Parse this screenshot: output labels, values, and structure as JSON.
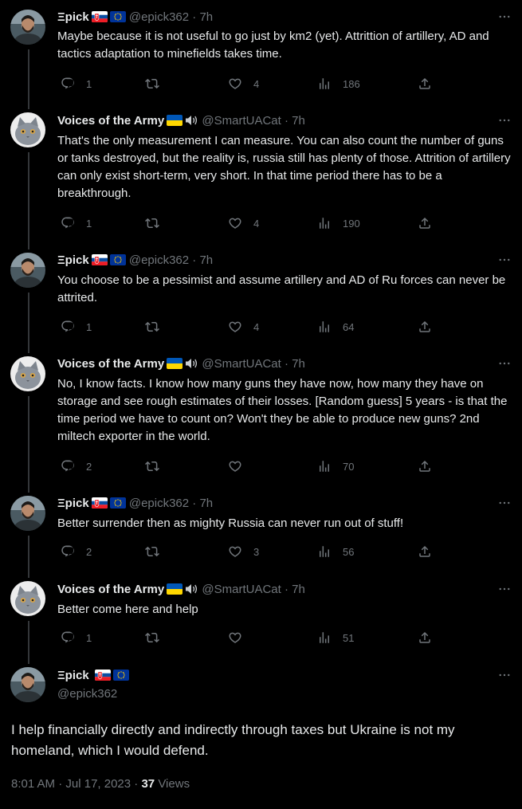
{
  "replies": [
    {
      "name": "Ξpick",
      "handle": "@epick362",
      "sep": "·",
      "time": "7h",
      "avatar": "bearded-man-avatar",
      "flags": [
        "slovakia-flag",
        "eu-flag"
      ],
      "text": "Maybe because it is not useful to go just by km2 (yet). Attrittion of artillery, AD and tactics adaptation to minefields takes time.",
      "replies": "1",
      "likes": "4",
      "views": "186"
    },
    {
      "name": "Voices of the Army",
      "handle": "@SmartUACat",
      "sep": "·",
      "time": "7h",
      "avatar": "gray-cat-avatar",
      "flags": [
        "ukraine-flag",
        "speaker-icon"
      ],
      "text": "That's the only measurement I can measure. You can also count the number of guns or tanks destroyed, but the reality is, russia still has plenty of those. Attrition of artillery can only exist short-term, very short. In that time period there has to be a breakthrough.",
      "replies": "1",
      "likes": "4",
      "views": "190"
    },
    {
      "name": "Ξpick",
      "handle": "@epick362",
      "sep": "·",
      "time": "7h",
      "avatar": "bearded-man-avatar",
      "flags": [
        "slovakia-flag",
        "eu-flag"
      ],
      "text": "You choose to be a pessimist and assume artillery and AD of Ru forces can never be attrited.",
      "replies": "1",
      "likes": "4",
      "views": "64"
    },
    {
      "name": "Voices of the Army",
      "handle": "@SmartUACat",
      "sep": "·",
      "time": "7h",
      "avatar": "gray-cat-avatar",
      "flags": [
        "ukraine-flag",
        "speaker-icon"
      ],
      "text": "No, I know facts. I know how many guns they have now, how many they have on storage and see rough estimates of their losses. [Random guess] 5 years - is that the time period we have to count on? Won't they be able to produce new guns? 2nd miltech exporter in the world.",
      "replies": "2",
      "likes": "",
      "views": "70"
    },
    {
      "name": "Ξpick",
      "handle": "@epick362",
      "sep": "·",
      "time": "7h",
      "avatar": "bearded-man-avatar",
      "flags": [
        "slovakia-flag",
        "eu-flag"
      ],
      "text": "Better surrender then as mighty Russia can never run out of stuff!",
      "replies": "2",
      "likes": "3",
      "views": "56"
    },
    {
      "name": "Voices of the Army",
      "handle": "@SmartUACat",
      "sep": "·",
      "time": "7h",
      "avatar": "gray-cat-avatar",
      "flags": [
        "ukraine-flag",
        "speaker-icon"
      ],
      "text": "Better come here and help",
      "replies": "1",
      "likes": "",
      "views": "51"
    }
  ],
  "main": {
    "name": "Ξpick",
    "handle": "@epick362",
    "flags": [
      "slovakia-flag",
      "eu-flag"
    ],
    "text": "I help financially directly and indirectly through taxes but Ukraine is not my homeland, which I would defend.",
    "time": "8:01 AM",
    "sep": "·",
    "date": "Jul 17, 2023",
    "sep2": "·",
    "views": "37",
    "views_label": "Views"
  },
  "colors": {
    "background": "#000000",
    "text": "#e7e9ea",
    "muted": "#71767b",
    "thread_line": "#333639"
  }
}
